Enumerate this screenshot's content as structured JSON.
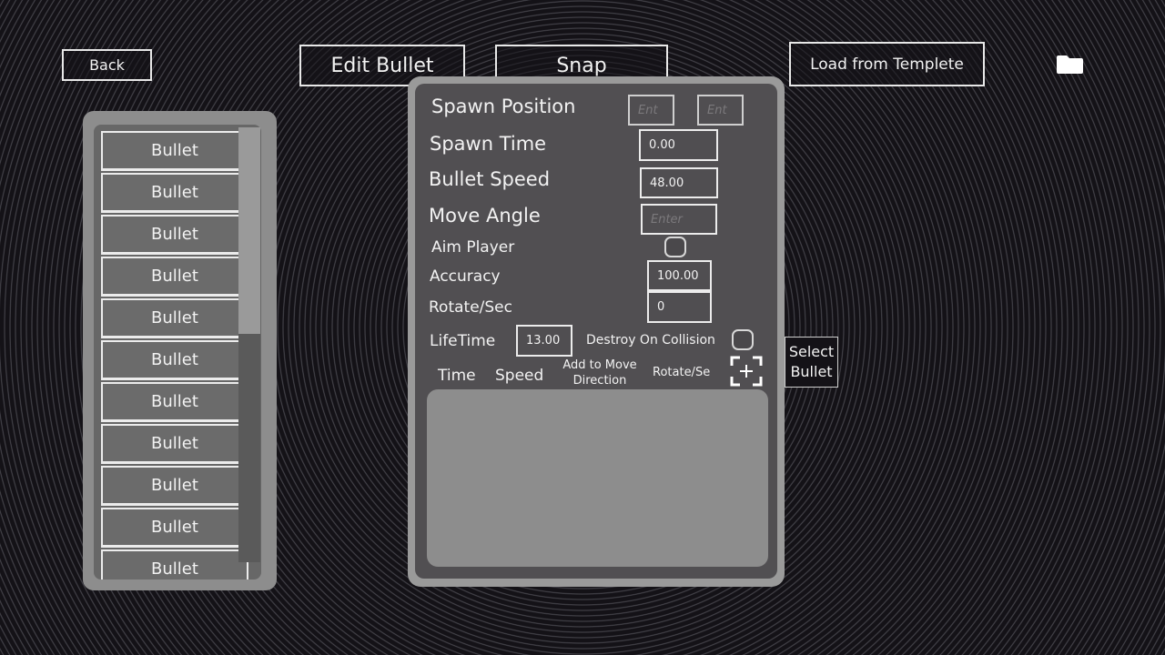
{
  "top_bar": {
    "back_label": "Back",
    "edit_bullet_label": "Edit Bullet",
    "snap_label": "Snap",
    "load_template_label": "Load from Templete",
    "folder_icon": "folder-icon"
  },
  "bullet_list": {
    "items": [
      "Bullet",
      "Bullet",
      "Bullet",
      "Bullet",
      "Bullet",
      "Bullet",
      "Bullet",
      "Bullet",
      "Bullet",
      "Bullet",
      "Bullet"
    ]
  },
  "editor": {
    "spawn_position": {
      "label": "Spawn Position",
      "x_placeholder": "Ent",
      "y_placeholder": "Ent"
    },
    "spawn_time": {
      "label": "Spawn Time",
      "value": "0.00"
    },
    "bullet_speed": {
      "label": "Bullet Speed",
      "value": "48.00"
    },
    "move_angle": {
      "label": "Move Angle",
      "placeholder": "Enter"
    },
    "aim_player": {
      "label": "Aim Player"
    },
    "accuracy": {
      "label": "Accuracy",
      "value": "100.00"
    },
    "rotate_sec": {
      "label": "Rotate/Sec",
      "value": "0"
    },
    "lifetime": {
      "label": "LifeTime",
      "value": "13.00"
    },
    "destroy_on_collision": {
      "label": "Destroy On Collision"
    },
    "events_header": {
      "time": "Time",
      "speed": "Speed",
      "add_to_move_direction_line1": "Add to Move",
      "add_to_move_direction_line2": "Direction",
      "rotate_se": "Rotate/Se"
    },
    "add_icon": "plus-icon",
    "select_bullet_line1": "Select",
    "select_bullet_line2": "Bullet"
  }
}
